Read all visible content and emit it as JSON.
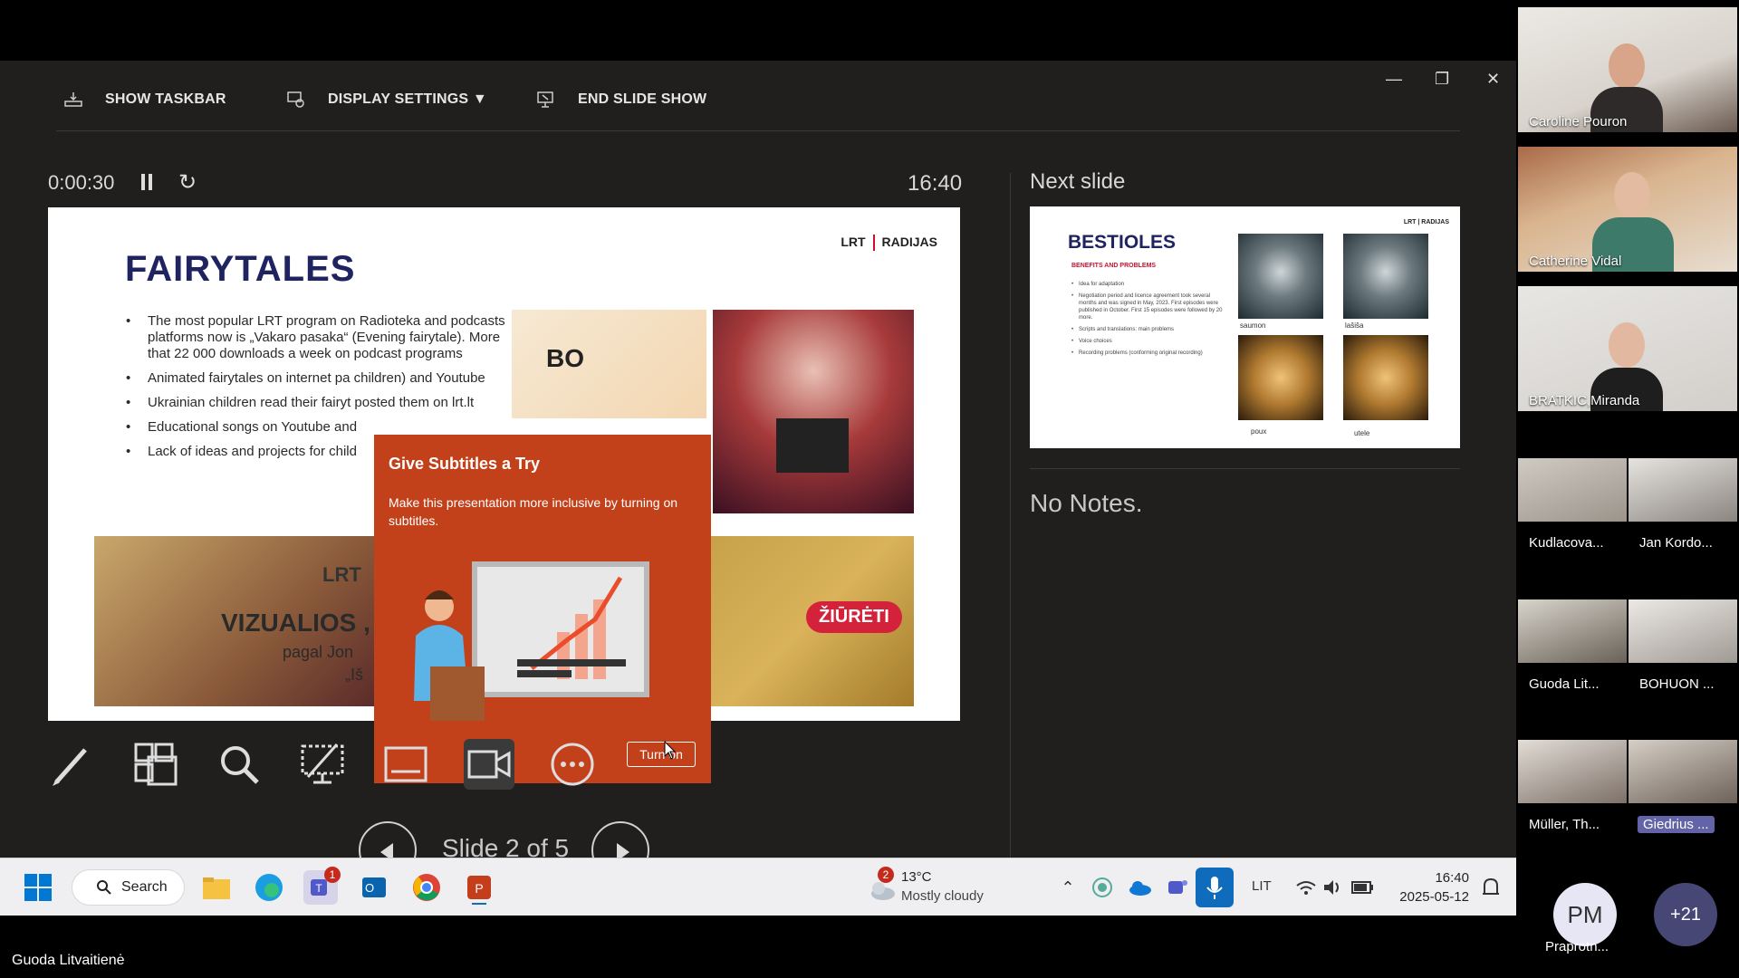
{
  "toolbar": {
    "show_taskbar": "SHOW TASKBAR",
    "display_settings": "DISPLAY SETTINGS ▼",
    "end_slide_show": "END SLIDE SHOW"
  },
  "presenter": {
    "timer": "0:00:30",
    "clock": "16:40",
    "next_slide_label": "Next slide",
    "notes": "No Notes.",
    "slide_counter": "Slide 2 of 5"
  },
  "current_slide": {
    "title": "FAIRYTALES",
    "logo": "LRT | RADIJAS",
    "logo_left": "LRT",
    "logo_right": "RADIJAS",
    "bullets": [
      "The most popular LRT program on Radioteka and podcasts platforms now is „Vakaro pasaka“ (Evening fairytale). More that 22 000 downloads a week on podcast programs",
      "Animated fairytales on internet pa children) and Youtube",
      "Ukrainian children read their fairyt posted them on lrt.lt",
      "Educational songs on Youtube and",
      "Lack of ideas and projects for child"
    ],
    "left_image_logo": "LRT",
    "left_image_big": "VIZUALIOS ,",
    "left_image_small": "pagal Jon",
    "left_image_small2": "„Iš",
    "top_image_text": "BO",
    "watch_button": "ŽIŪRĖTI"
  },
  "popup": {
    "title": "Give Subtitles a Try",
    "text": "Make this presentation more inclusive by turning on subtitles.",
    "button": "Turn on"
  },
  "next_slide": {
    "title": "BESTIOLES",
    "subtitle": "BENEFITS AND PROBLEMS",
    "logo": "LRT | RADIJAS",
    "bullets": [
      "Idea for adaptation",
      "Negotiation period and licence agreement took several months and was signed in May, 2023. First episodes were published in October. First 15 episodes were followed by 20 more.",
      "Scripts and translations: main problems",
      "Voice choices",
      "Recording problems (conforming original recording)"
    ],
    "captions": [
      "saumon",
      "lašiša",
      "poux",
      "utele"
    ]
  },
  "taskbar": {
    "search": "Search",
    "teams_badge": "1",
    "weather_badge": "2",
    "temperature": "13°C",
    "condition": "Mostly cloudy",
    "language": "LIT",
    "time": "16:40",
    "date": "2025-05-12"
  },
  "active_speaker": "Guoda Litvaitienė",
  "participants": {
    "large": [
      "Caroline Pouron",
      "Catherine Vidal",
      "BRATKIC,Miranda"
    ],
    "small": [
      "Kudlacova...",
      "Jan Kordo...",
      "Guoda Lit...",
      "BOHUON ...",
      "Müller, Th...",
      "Giedrius ..."
    ],
    "avatar_initials": "PM",
    "avatar_name": "Praprotn...",
    "more": "+21"
  }
}
